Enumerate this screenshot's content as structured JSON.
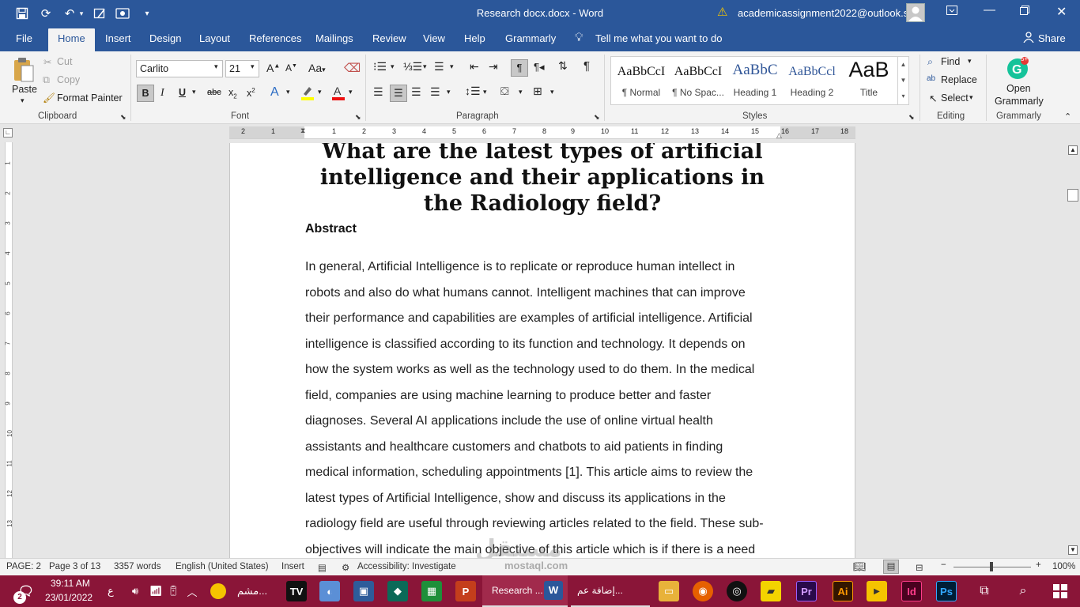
{
  "titlebar": {
    "doc_title": "Research docx.docx  -  Word",
    "account": "academicassignment2022@outlook.sa"
  },
  "tabs": [
    "File",
    "Home",
    "Insert",
    "Design",
    "Layout",
    "References",
    "Mailings",
    "Review",
    "View",
    "Help",
    "Grammarly"
  ],
  "tell_me": "Tell me what you want to do",
  "share": "Share",
  "clipboard": {
    "paste": "Paste",
    "cut": "Cut",
    "copy": "Copy",
    "format_painter": "Format Painter",
    "label": "Clipboard"
  },
  "font": {
    "name": "Carlito",
    "size": "21",
    "label": "Font"
  },
  "paragraph": {
    "label": "Paragraph"
  },
  "styles": {
    "items": [
      {
        "sample": "AaBbCcI",
        "name": "¶ Normal"
      },
      {
        "sample": "AaBbCcI",
        "name": "¶ No Spac..."
      },
      {
        "sample": "AaBbC",
        "name": "Heading 1"
      },
      {
        "sample": "AaBbCcl",
        "name": "Heading 2"
      },
      {
        "sample": "AaB",
        "name": "Title"
      }
    ],
    "label": "Styles"
  },
  "editing": {
    "find": "Find",
    "replace": "Replace",
    "select": "Select",
    "label": "Editing"
  },
  "grammarly": {
    "open": "Open",
    "name": "Grammarly",
    "label": "Grammarly",
    "badge": "5+"
  },
  "ruler": {
    "numbers": [
      "2",
      "1",
      "1",
      "2",
      "3",
      "4",
      "5",
      "6",
      "7",
      "8",
      "9",
      "10",
      "11",
      "12",
      "13",
      "14",
      "15",
      "16",
      "17",
      "18"
    ]
  },
  "document": {
    "title": "What are the latest types of artificial intelligence and their applications in the Radiology field?",
    "abstract_heading": "Abstract",
    "body_lines": [
      "In general, Artificial Intelligence is to replicate or reproduce human intellect in",
      "robots and also do what humans cannot. Intelligent machines that can improve",
      "their performance and capabilities are examples of artificial intelligence. Artificial",
      "intelligence is classified according to its function and technology. It depends on",
      "how the system works as well as the technology used to do them. In the medical",
      "field, companies are using machine learning to produce better and faster",
      "diagnoses. Several AI applications include the use of online virtual health",
      "assistants and healthcare customers and chatbots to aid patients in finding",
      "medical information, scheduling appointments [1]. This article aims to review the",
      "latest types of Artificial Intelligence, show and discuss its applications in the",
      "radiology field are useful through reviewing articles related to the field. These sub-",
      "objectives will indicate the main objective of this article which is if there is a need"
    ]
  },
  "status": {
    "page_section": "PAGE: 2",
    "page": "Page 3 of 13",
    "words": "3357 words",
    "language": "English (United States)",
    "mode": "Insert",
    "accessibility": "Accessibility: Investigate",
    "zoom": "100%"
  },
  "taskbar": {
    "time": "39:11 AM",
    "date": "23/01/2022",
    "notification_count": "2",
    "lang": "ع",
    "weather_label": "مشم...",
    "word_task": "Research ...",
    "browser_task": "إضافة عم..."
  },
  "watermark": {
    "line1": "مستقل",
    "line2": "mostaql.com"
  },
  "colors": {
    "word_blue": "#2b579a",
    "taskbar": "#8a1538"
  }
}
